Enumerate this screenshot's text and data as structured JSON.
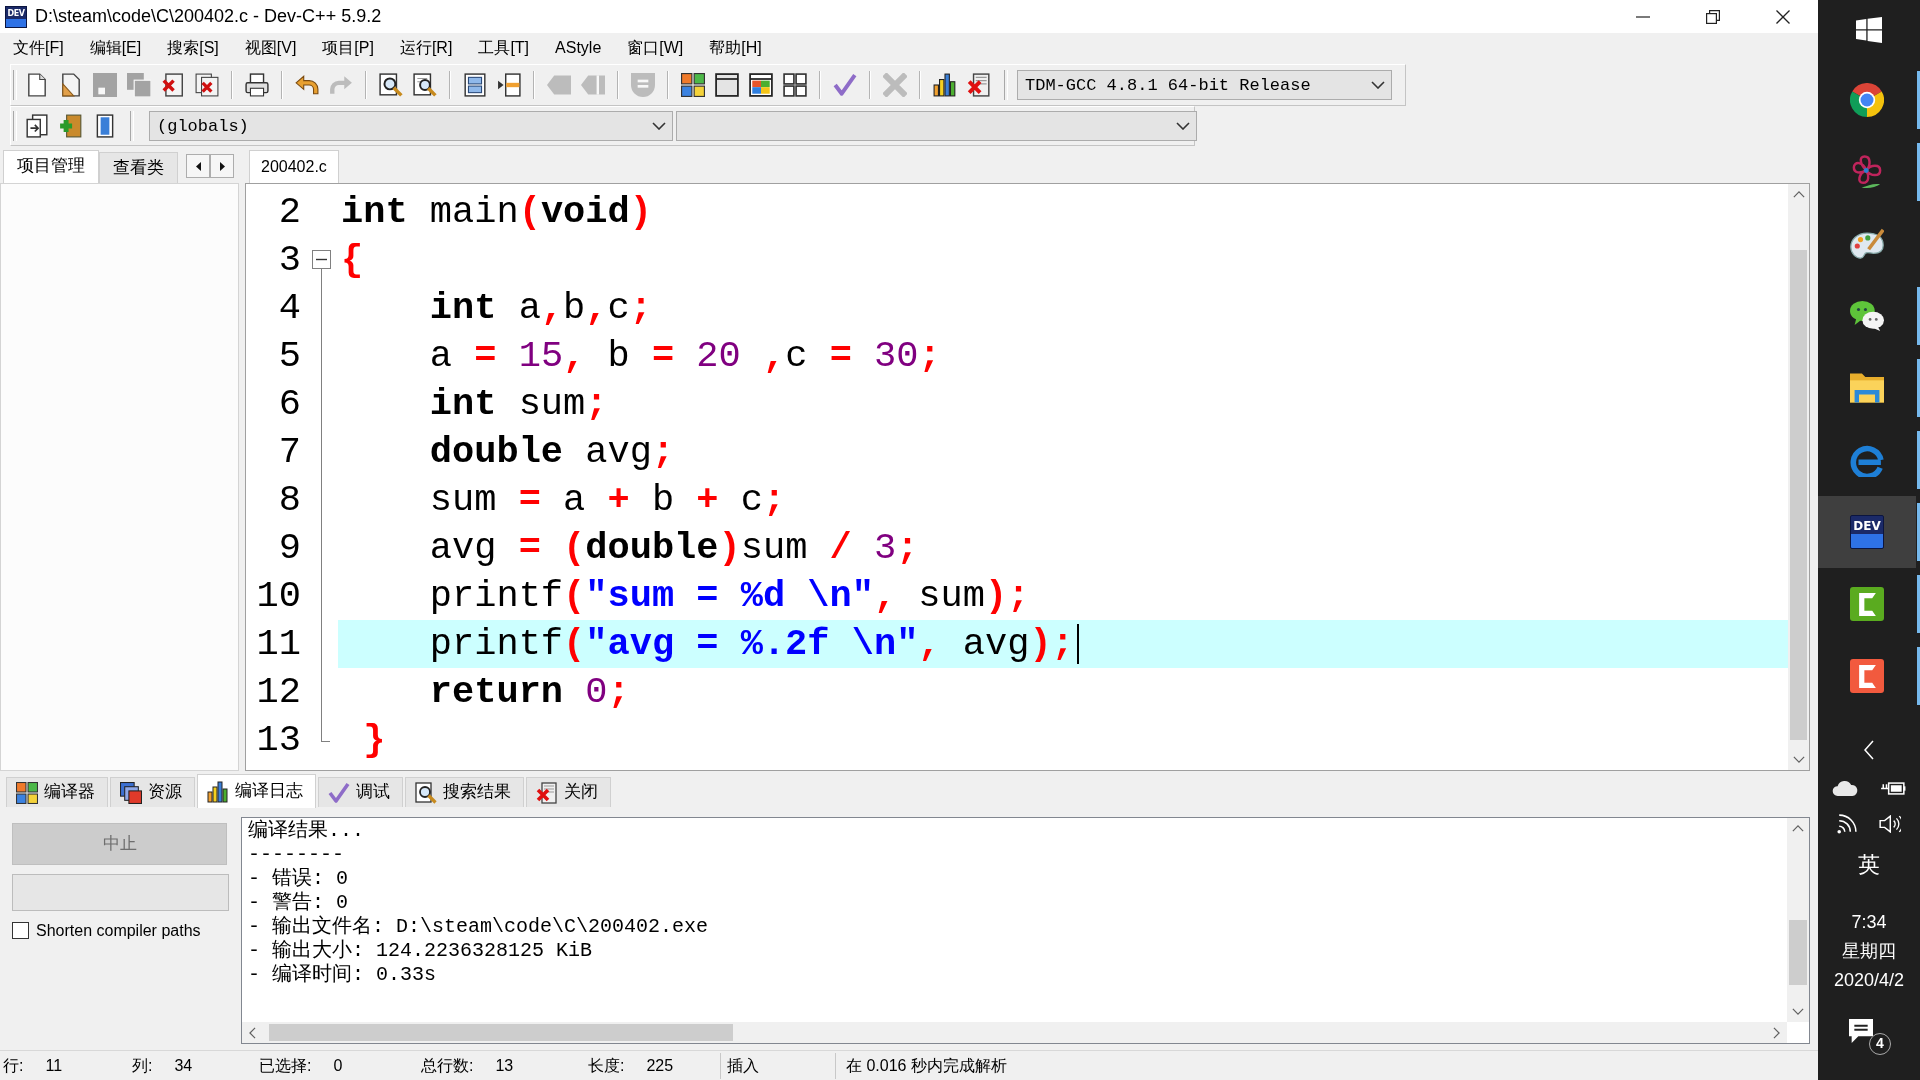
{
  "window": {
    "title": "D:\\steam\\code\\C\\200402.c - Dev-C++ 5.9.2",
    "logo_text": "DEV"
  },
  "menu": [
    "文件[F]",
    "编辑[E]",
    "搜索[S]",
    "视图[V]",
    "项目[P]",
    "运行[R]",
    "工具[T]",
    "AStyle",
    "窗口[W]",
    "帮助[H]"
  ],
  "toolbar": {
    "groups": [
      [
        {
          "kind": "new",
          "disabled": false
        },
        {
          "kind": "open",
          "disabled": false
        },
        {
          "kind": "save",
          "disabled": true
        },
        {
          "kind": "saveall",
          "disabled": true
        },
        {
          "kind": "close",
          "disabled": false
        },
        {
          "kind": "closeall",
          "disabled": false
        }
      ],
      [
        {
          "kind": "print",
          "disabled": false
        }
      ],
      [
        {
          "kind": "undo",
          "disabled": false
        },
        {
          "kind": "redo",
          "disabled": true
        }
      ],
      [
        {
          "kind": "find",
          "disabled": false
        },
        {
          "kind": "replace",
          "disabled": false
        }
      ],
      [
        {
          "kind": "indent",
          "disabled": false
        },
        {
          "kind": "unindent",
          "disabled": false
        }
      ],
      [
        {
          "kind": "back",
          "disabled": true
        },
        {
          "kind": "forward",
          "disabled": true
        }
      ],
      [
        {
          "kind": "toggle",
          "disabled": true
        }
      ],
      [
        {
          "kind": "compile",
          "disabled": false
        },
        {
          "kind": "run",
          "disabled": false
        },
        {
          "kind": "compilerun",
          "disabled": false
        },
        {
          "kind": "rebuild",
          "disabled": false
        }
      ],
      [
        {
          "kind": "debug",
          "disabled": false
        }
      ],
      [
        {
          "kind": "stop",
          "disabled": true
        }
      ],
      [
        {
          "kind": "profile",
          "disabled": false
        },
        {
          "kind": "unprofile",
          "disabled": false
        }
      ]
    ],
    "compiler": "TDM-GCC 4.8.1 64-bit Release"
  },
  "toolbar_2": {
    "buttons": [
      {
        "kind": "project",
        "disabled": false
      },
      {
        "kind": "addfile",
        "disabled": false
      },
      {
        "kind": "classes",
        "disabled": false
      }
    ],
    "scope": "(globals)"
  },
  "side_tabs": [
    {
      "label": "项目管理",
      "selected": true
    },
    {
      "label": "查看类",
      "selected": false
    }
  ],
  "editor": {
    "tabs": [
      {
        "label": "200402.c",
        "selected": true
      }
    ],
    "lines": [
      {
        "number": "2",
        "kind": "plain",
        "current": false,
        "tokens": [
          {
            "text": "int",
            "kind": "keyword"
          },
          {
            "text": " main",
            "kind": "name"
          },
          {
            "text": "(",
            "kind": "symbol"
          },
          {
            "text": "void",
            "kind": "keyword"
          },
          {
            "text": ")",
            "kind": "symbol"
          }
        ]
      },
      {
        "number": "3",
        "kind": "opener",
        "current": false,
        "tokens": [
          {
            "text": "{",
            "kind": "symbol"
          }
        ]
      },
      {
        "number": "4",
        "kind": "body",
        "current": false,
        "tokens": [
          {
            "text": "    int",
            "kind": "keyword"
          },
          {
            "text": " a",
            "kind": "name"
          },
          {
            "text": ",",
            "kind": "symbol"
          },
          {
            "text": "b",
            "kind": "name"
          },
          {
            "text": ",",
            "kind": "symbol"
          },
          {
            "text": "c",
            "kind": "name"
          },
          {
            "text": ";",
            "kind": "symbol"
          }
        ]
      },
      {
        "number": "5",
        "kind": "body",
        "current": false,
        "tokens": [
          {
            "text": "    a",
            "kind": "name"
          },
          {
            "text": " =",
            "kind": "symbol"
          },
          {
            "text": " 15",
            "kind": "number"
          },
          {
            "text": ",",
            "kind": "symbol"
          },
          {
            "text": " b",
            "kind": "name"
          },
          {
            "text": " =",
            "kind": "symbol"
          },
          {
            "text": " 20",
            "kind": "number"
          },
          {
            "text": " ,",
            "kind": "symbol"
          },
          {
            "text": "c",
            "kind": "name"
          },
          {
            "text": " =",
            "kind": "symbol"
          },
          {
            "text": " 30",
            "kind": "number"
          },
          {
            "text": ";",
            "kind": "symbol"
          }
        ]
      },
      {
        "number": "6",
        "kind": "body",
        "current": false,
        "tokens": [
          {
            "text": "    int",
            "kind": "keyword"
          },
          {
            "text": " sum",
            "kind": "name"
          },
          {
            "text": ";",
            "kind": "symbol"
          }
        ]
      },
      {
        "number": "7",
        "kind": "body",
        "current": false,
        "tokens": [
          {
            "text": "    double",
            "kind": "keyword"
          },
          {
            "text": " avg",
            "kind": "name"
          },
          {
            "text": ";",
            "kind": "symbol"
          }
        ]
      },
      {
        "number": "8",
        "kind": "body",
        "current": false,
        "tokens": [
          {
            "text": "    sum",
            "kind": "name"
          },
          {
            "text": " =",
            "kind": "symbol"
          },
          {
            "text": " a",
            "kind": "name"
          },
          {
            "text": " +",
            "kind": "symbol"
          },
          {
            "text": " b",
            "kind": "name"
          },
          {
            "text": " +",
            "kind": "symbol"
          },
          {
            "text": " c",
            "kind": "name"
          },
          {
            "text": ";",
            "kind": "symbol"
          }
        ]
      },
      {
        "number": "9",
        "kind": "body",
        "current": false,
        "tokens": [
          {
            "text": "    avg",
            "kind": "name"
          },
          {
            "text": " =",
            "kind": "symbol"
          },
          {
            "text": " (",
            "kind": "symbol"
          },
          {
            "text": "double",
            "kind": "keyword"
          },
          {
            "text": ")",
            "kind": "symbol"
          },
          {
            "text": "sum",
            "kind": "name"
          },
          {
            "text": " /",
            "kind": "symbol"
          },
          {
            "text": " 3",
            "kind": "number"
          },
          {
            "text": ";",
            "kind": "symbol"
          }
        ]
      },
      {
        "number": "10",
        "kind": "body",
        "current": false,
        "tokens": [
          {
            "text": "    printf",
            "kind": "name"
          },
          {
            "text": "(",
            "kind": "symbol"
          },
          {
            "text": "\"sum = %d \\n\"",
            "kind": "string"
          },
          {
            "text": ",",
            "kind": "symbol"
          },
          {
            "text": " sum",
            "kind": "name"
          },
          {
            "text": ")",
            "kind": "symbol"
          },
          {
            "text": ";",
            "kind": "symbol"
          }
        ]
      },
      {
        "number": "11",
        "kind": "body",
        "current": true,
        "tokens": [
          {
            "text": "    printf",
            "kind": "name"
          },
          {
            "text": "(",
            "kind": "symbol"
          },
          {
            "text": "\"avg = %.2f \\n\"",
            "kind": "string"
          },
          {
            "text": ",",
            "kind": "symbol"
          },
          {
            "text": " avg",
            "kind": "name"
          },
          {
            "text": ")",
            "kind": "symbol"
          },
          {
            "text": ";",
            "kind": "symbol"
          }
        ]
      },
      {
        "number": "12",
        "kind": "body",
        "current": false,
        "tokens": [
          {
            "text": "    return",
            "kind": "keyword"
          },
          {
            "text": " 0",
            "kind": "number"
          },
          {
            "text": ";",
            "kind": "symbol"
          }
        ]
      },
      {
        "number": "13",
        "kind": "closer",
        "current": false,
        "tokens": [
          {
            "text": " }",
            "kind": "symbol"
          }
        ]
      }
    ]
  },
  "bottom_tabs": [
    {
      "label": "编译器",
      "kind": "compiler",
      "selected": false
    },
    {
      "label": "资源",
      "kind": "resources",
      "selected": false
    },
    {
      "label": "编译日志",
      "kind": "log",
      "selected": true
    },
    {
      "label": "调试",
      "kind": "debug",
      "selected": false
    },
    {
      "label": "搜索结果",
      "kind": "search",
      "selected": false
    },
    {
      "label": "关闭",
      "kind": "close",
      "selected": false
    }
  ],
  "compile_panel": {
    "abort_button": {
      "label": "中止",
      "disabled": true
    },
    "progress": {
      "level": 0
    },
    "shorten_paths": {
      "label": "Shorten compiler paths",
      "checked": false
    },
    "log": [
      "编译结果...",
      "--------",
      "- 错误: 0",
      "- 警告: 0",
      "- 输出文件名: D:\\steam\\code\\C\\200402.exe",
      "- 输出大小: 124.2236328125 KiB",
      "- 编译时间: 0.33s"
    ]
  },
  "status_bar": {
    "fields": [
      {
        "label": "行:",
        "value": "11"
      },
      {
        "label": "列:",
        "value": "34"
      },
      {
        "label": "已选择:",
        "value": "0"
      },
      {
        "label": "总行数:",
        "value": "13"
      },
      {
        "label": "长度:",
        "value": "225"
      }
    ],
    "mode": "插入",
    "message": "在 0.016 秒内完成解析"
  },
  "taskbar": {
    "apps": [
      {
        "kind": "browser",
        "running": true,
        "selected": false
      },
      {
        "kind": "flower",
        "running": true,
        "selected": false
      },
      {
        "kind": "palette",
        "running": false,
        "selected": false
      },
      {
        "kind": "chat",
        "running": true,
        "selected": false
      },
      {
        "kind": "folder",
        "running": true,
        "selected": false
      },
      {
        "kind": "letter",
        "running": true,
        "selected": false
      },
      {
        "kind": "ide",
        "logo_text": "DEV",
        "running": true,
        "selected": true
      },
      {
        "kind": "ctile",
        "color": "#5aab1f",
        "running": true,
        "selected": false
      },
      {
        "kind": "ctile",
        "color": "#f25a3e",
        "running": true,
        "selected": false
      }
    ],
    "input_mode": "英",
    "clock": {
      "time": "7:34",
      "weekday": "星期四",
      "date": "2020/4/2"
    },
    "notification_count": "4"
  }
}
